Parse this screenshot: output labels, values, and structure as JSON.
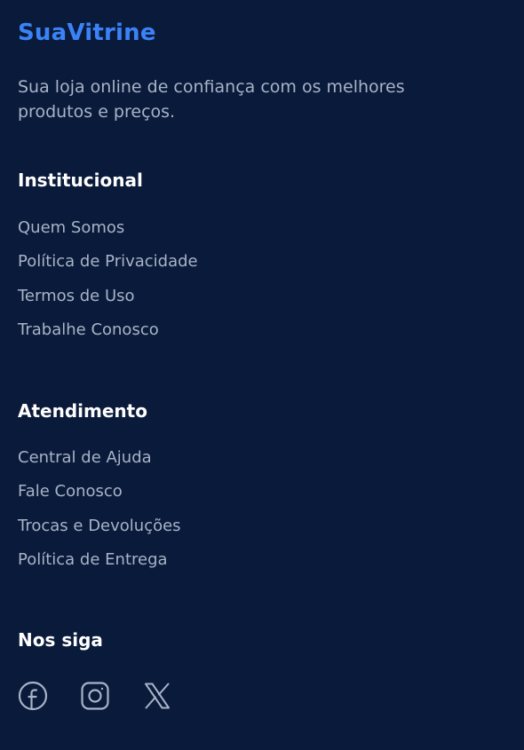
{
  "brand": {
    "name": "SuaVitrine",
    "tagline": "Sua loja online de confiança com os melhores produtos e preços.",
    "accent_color": "#3b82f6"
  },
  "sections": {
    "institucional": {
      "title": "Institucional",
      "links": [
        "Quem Somos",
        "Política de Privacidade",
        "Termos de Uso",
        "Trabalhe Conosco"
      ]
    },
    "atendimento": {
      "title": "Atendimento",
      "links": [
        "Central de Ajuda",
        "Fale Conosco",
        "Trocas e Devoluções",
        "Política de Entrega"
      ]
    },
    "social": {
      "title": "Nos siga",
      "icons": [
        "facebook-icon",
        "instagram-icon",
        "x-icon"
      ]
    }
  },
  "colors": {
    "background": "#0a1a3a",
    "heading": "#ffffff",
    "text": "#a8b3c7"
  }
}
